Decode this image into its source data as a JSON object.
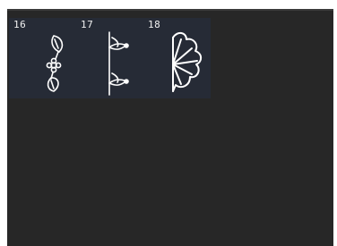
{
  "stitch_grid": {
    "items": [
      {
        "number": "16",
        "icon": "leaf-flower-vine-stitch-icon"
      },
      {
        "number": "17",
        "icon": "branch-leaf-stitch-icon"
      },
      {
        "number": "18",
        "icon": "scallop-fan-stitch-icon"
      }
    ]
  },
  "colors": {
    "screen_bg": "#272727",
    "tile_bg": "#262b36",
    "icon": "#ffffff"
  }
}
